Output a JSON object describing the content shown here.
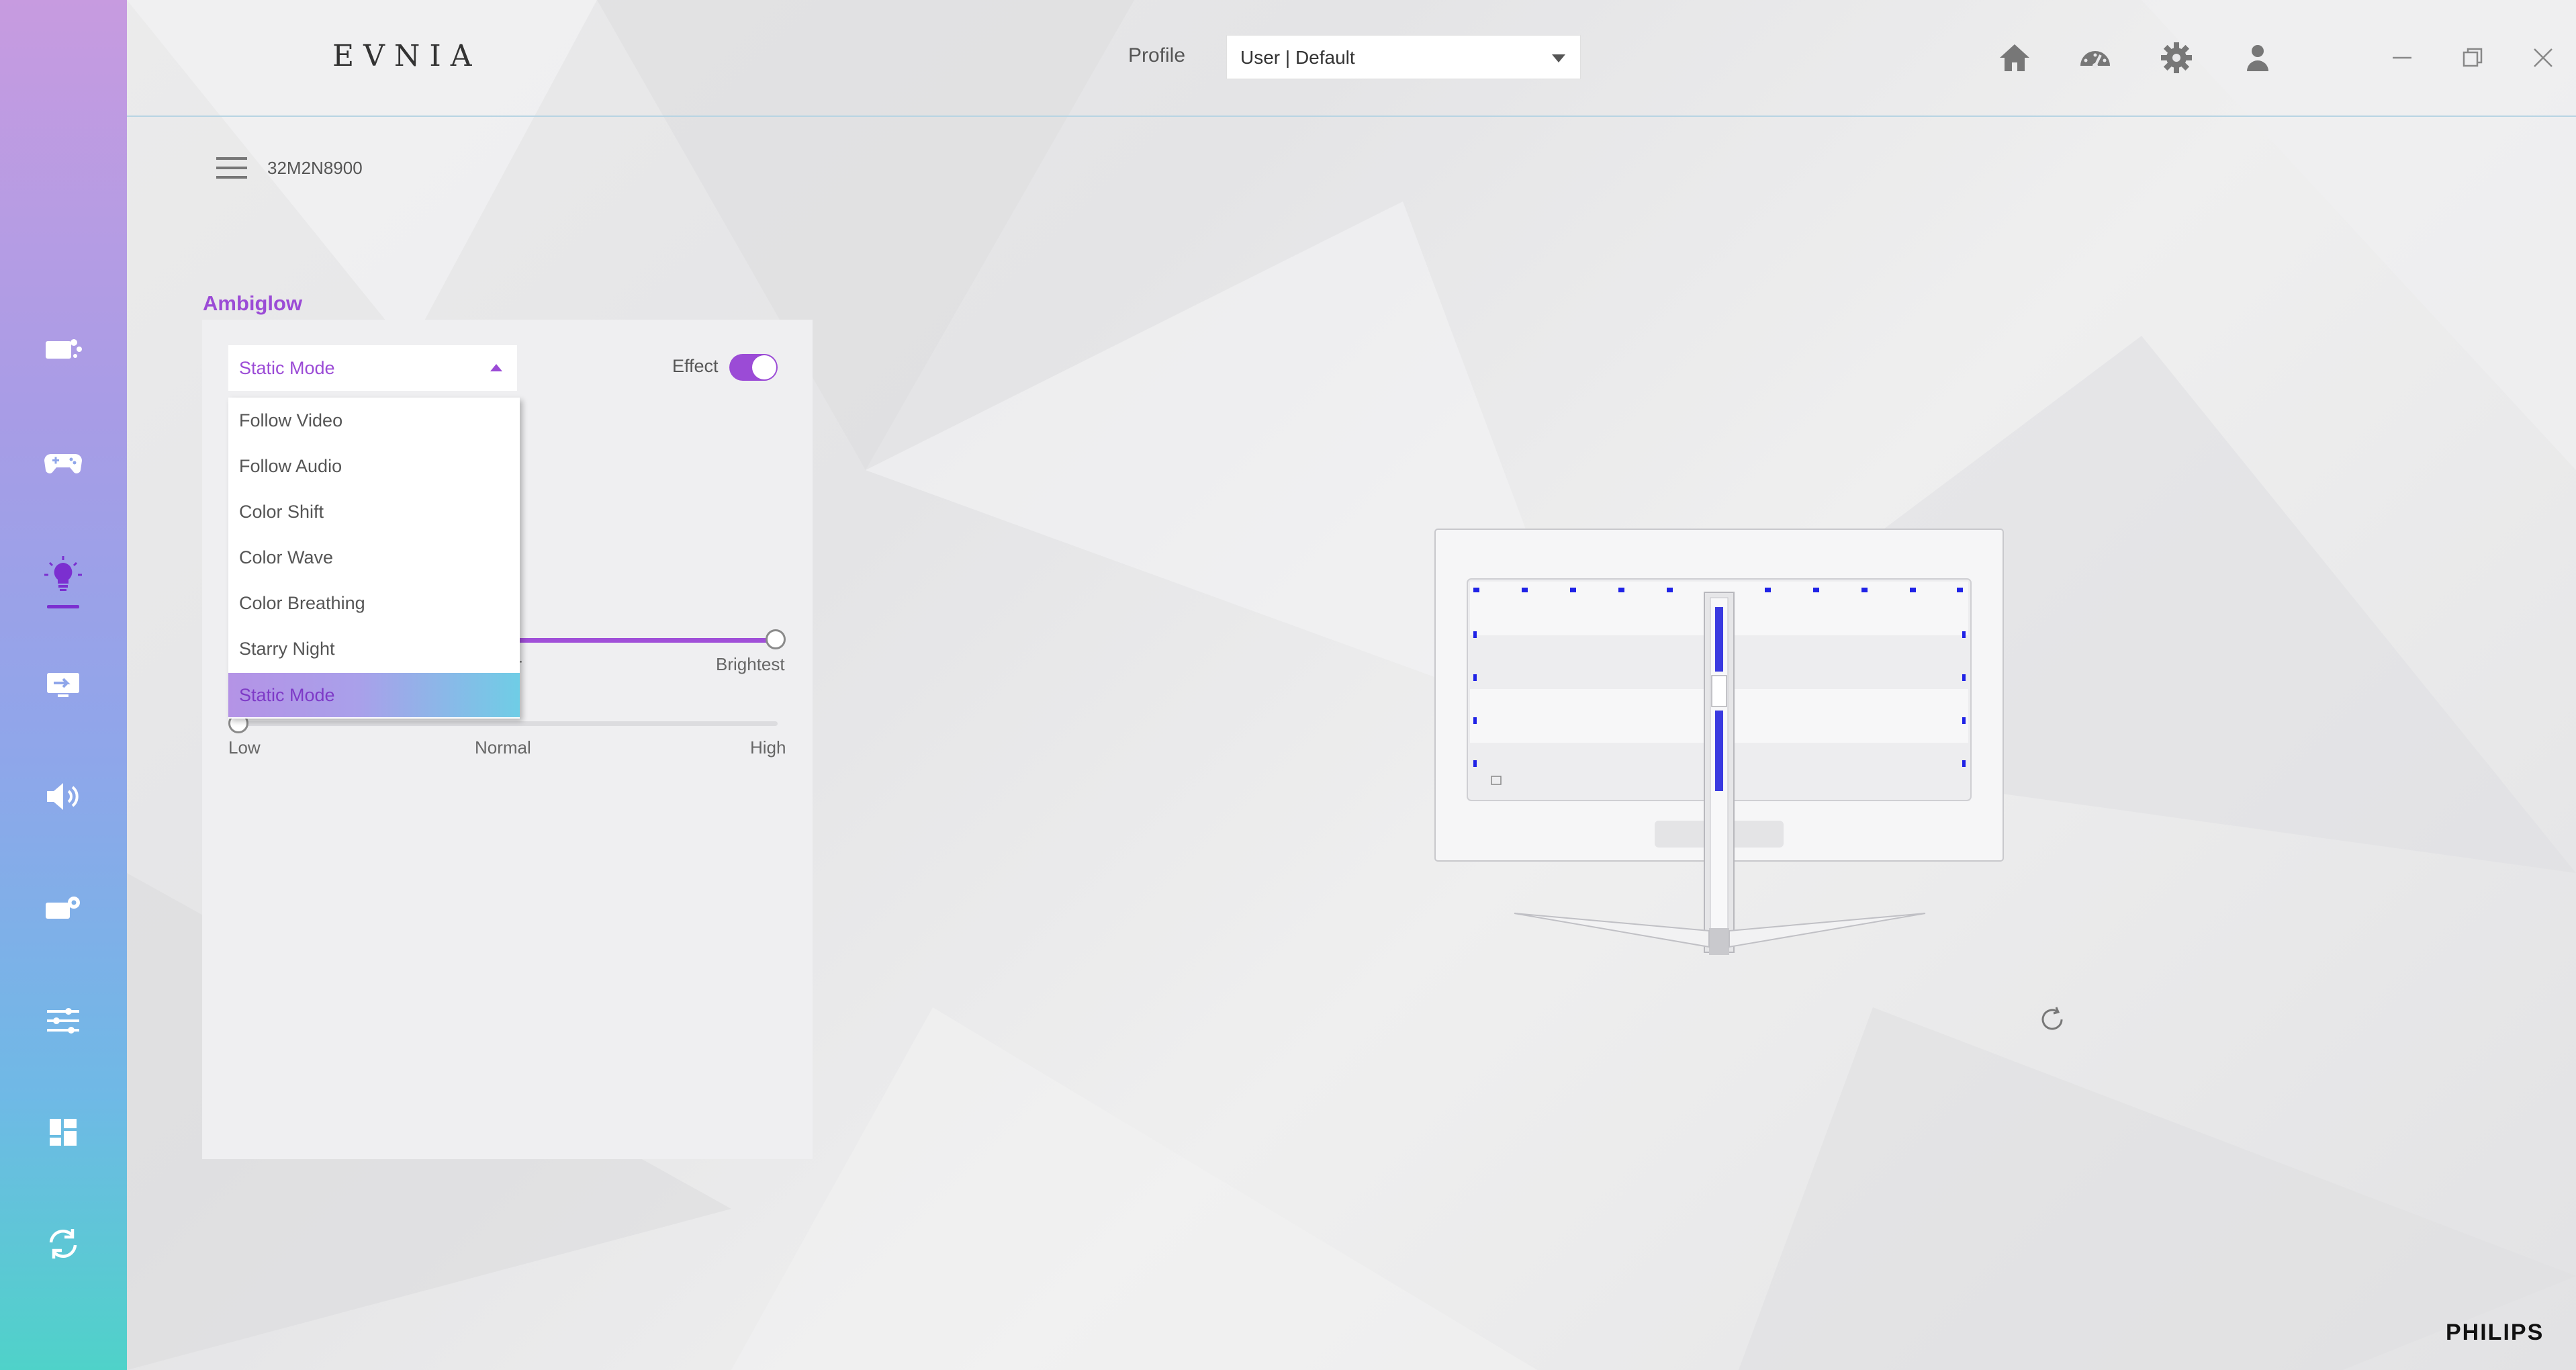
{
  "app": {
    "brand": "EVNIA"
  },
  "header": {
    "profile_label": "Profile",
    "profile_value": "User | Default",
    "icons": [
      "home-icon",
      "dashboard-icon",
      "gear-icon",
      "user-icon"
    ],
    "window_controls": [
      "minimize-icon",
      "restore-icon",
      "close-icon"
    ]
  },
  "device": {
    "name": "32M2N8900"
  },
  "sidebar": {
    "items": [
      {
        "icon": "monitor-display-icon",
        "active": false
      },
      {
        "icon": "gamepad-icon",
        "active": false
      },
      {
        "icon": "lightbulb-icon",
        "active": true
      },
      {
        "icon": "input-source-icon",
        "active": false
      },
      {
        "icon": "speaker-icon",
        "active": false
      },
      {
        "icon": "monitor-settings-icon",
        "active": false
      },
      {
        "icon": "sliders-icon",
        "active": false
      },
      {
        "icon": "widgets-icon",
        "active": false
      },
      {
        "icon": "sync-icon",
        "active": false
      }
    ]
  },
  "ambiglow": {
    "title": "Ambiglow",
    "mode_selected": "Static Mode",
    "effect_label": "Effect",
    "effect_enabled": true,
    "brightness": {
      "label_partial": "er",
      "max_label": "Brightest",
      "value_fraction": 1.0
    },
    "speed": {
      "labels": [
        "Low",
        "Normal",
        "High"
      ],
      "value_fraction": 0.0
    },
    "mode_options": [
      "Follow Video",
      "Follow Audio",
      "Color Shift",
      "Color Wave",
      "Color Breathing",
      "Starry Night",
      "Static Mode"
    ]
  },
  "colors": {
    "accent": "#9b4bd6",
    "led": "#2a2de0"
  },
  "footer": {
    "brand": "PHILIPS"
  }
}
